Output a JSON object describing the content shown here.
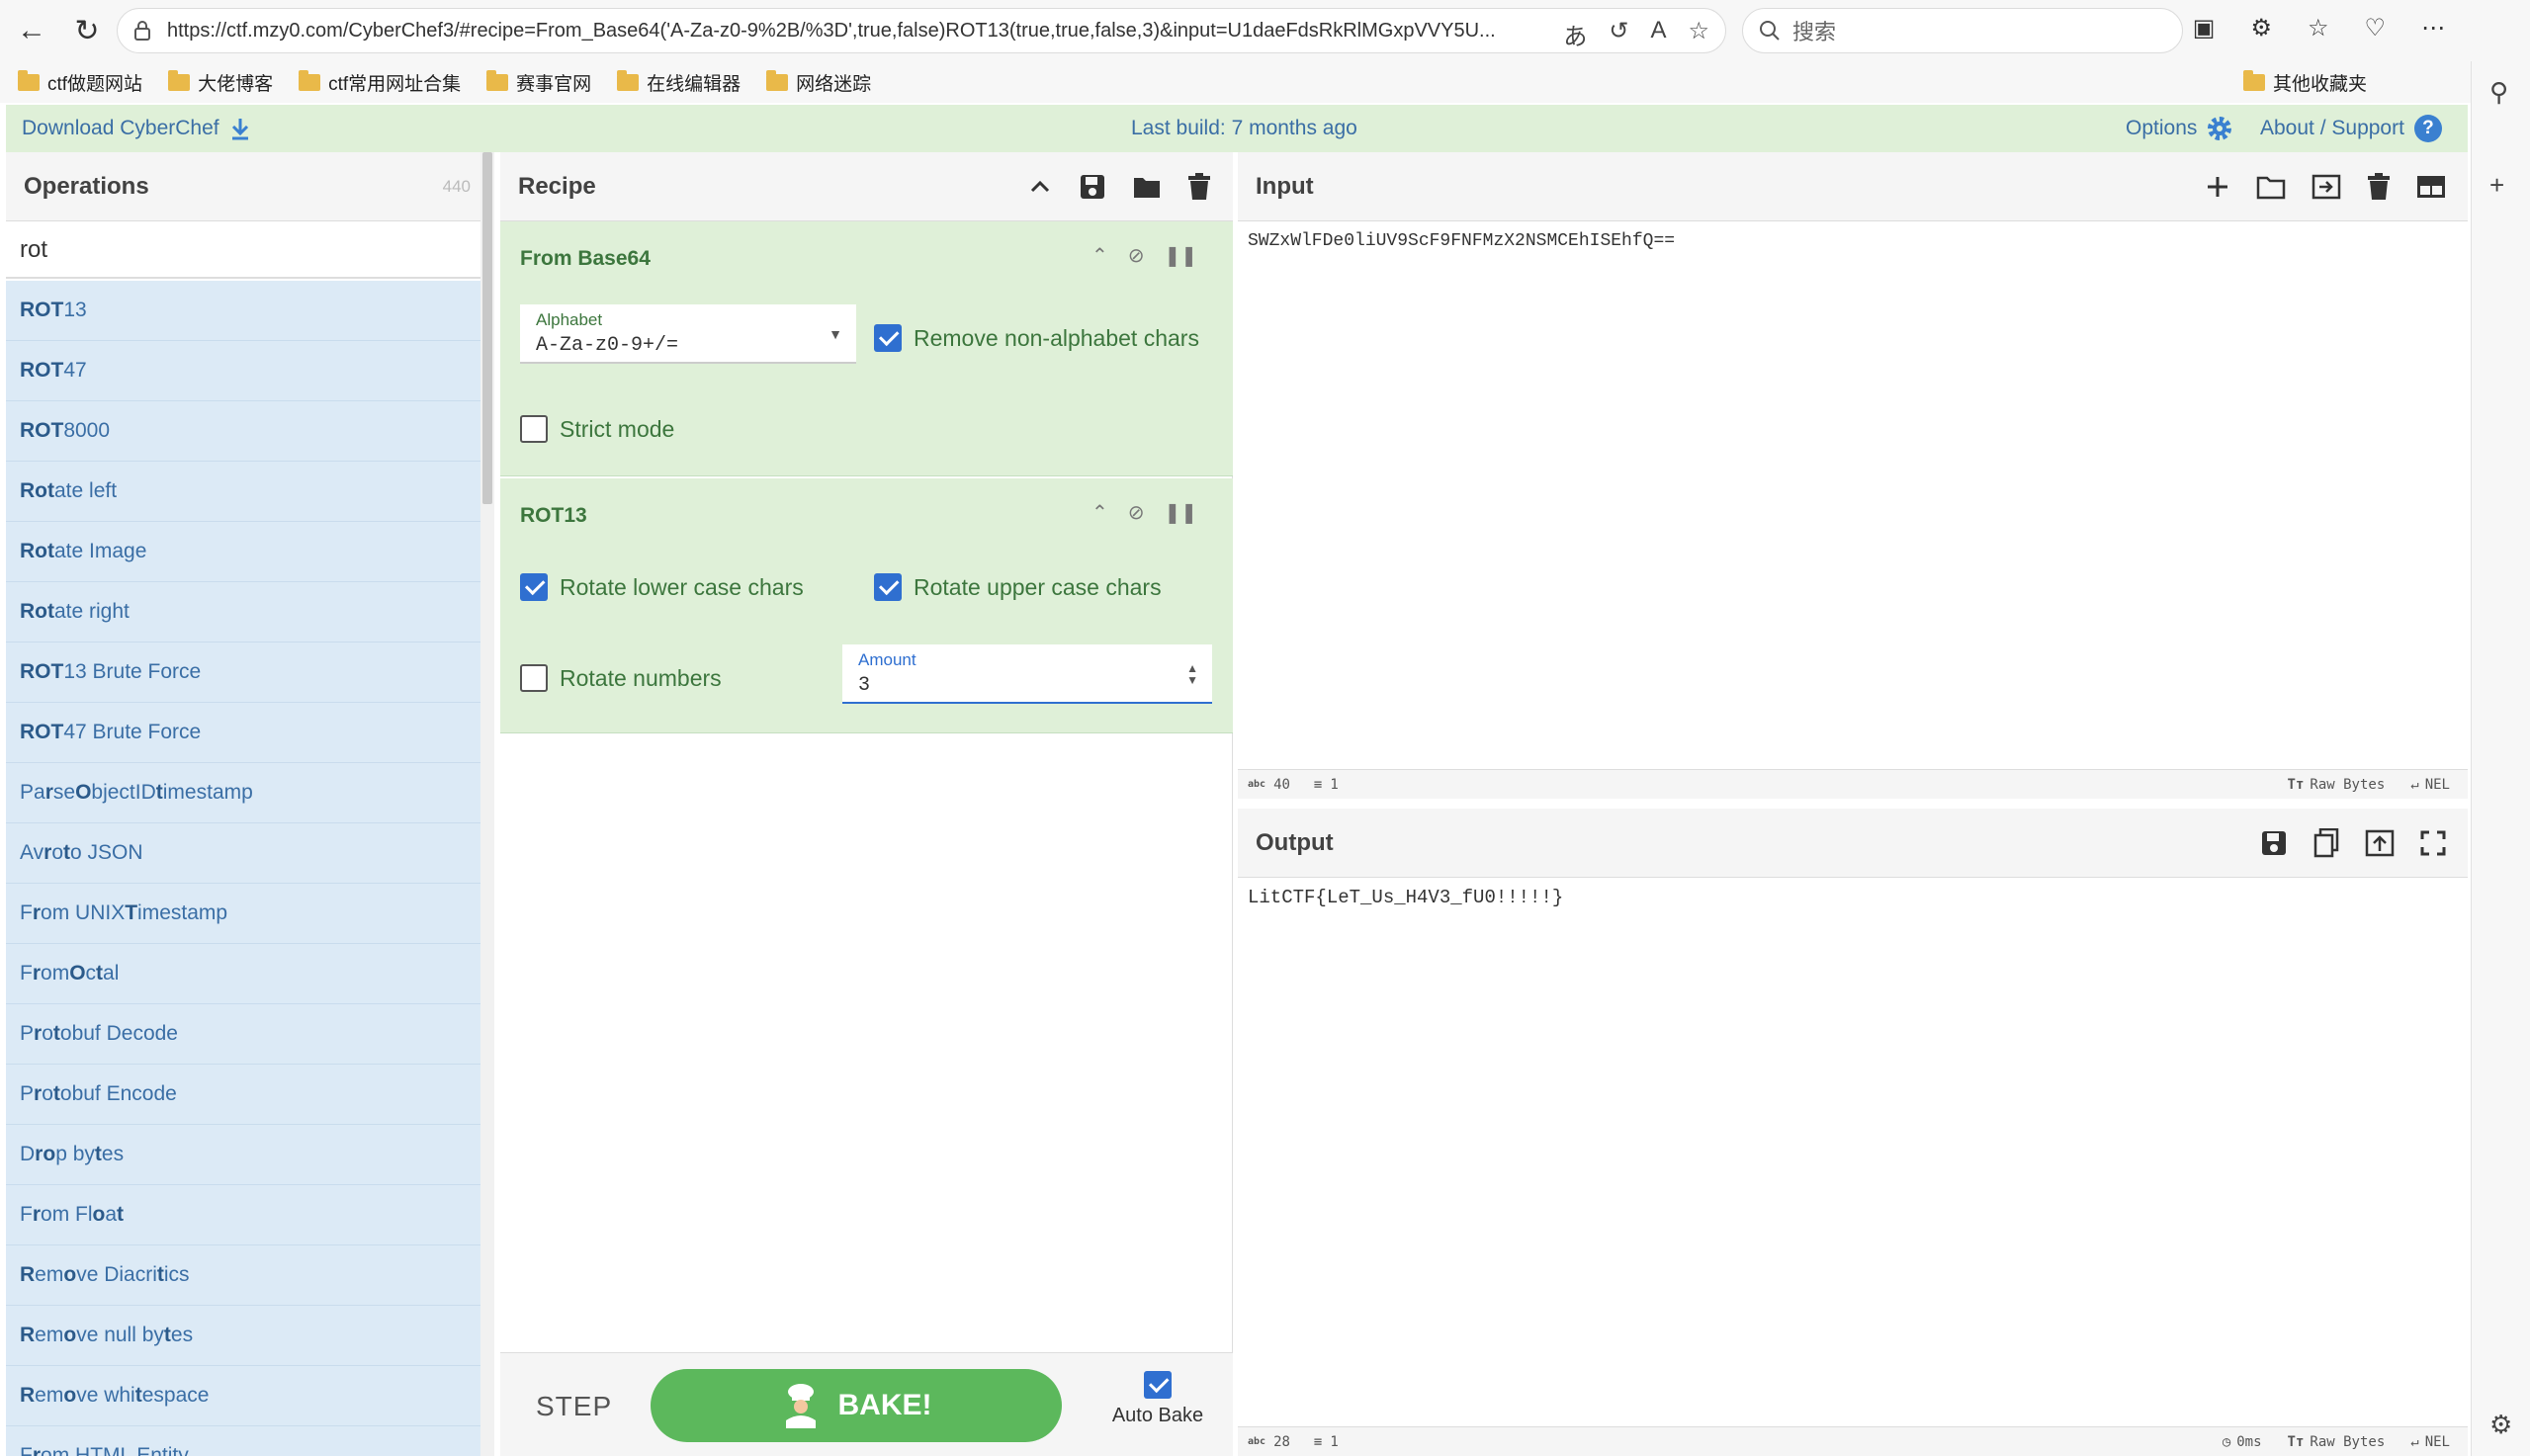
{
  "browser": {
    "url": "https://ctf.mzy0.com/CyberChef3/#recipe=From_Base64('A-Za-z0-9%2B/%3D',true,false)ROT13(true,true,false,3)&input=U1daeFdsRkRlMGxpVVY5U...",
    "search_placeholder": "搜索",
    "bookmarks": [
      "ctf做题网站",
      "大佬博客",
      "ctf常用网址合集",
      "赛事官网",
      "在线编辑器",
      "网络迷踪"
    ],
    "other_bookmarks": "其他收藏夹"
  },
  "banner": {
    "download": "Download CyberChef",
    "last_build": "Last build: 7 months ago",
    "options": "Options",
    "about": "About / Support"
  },
  "operations": {
    "title": "Operations",
    "count": "440",
    "search_value": "rot",
    "items": [
      {
        "bold": "ROT",
        "rest": "13"
      },
      {
        "bold": "ROT",
        "rest": "47"
      },
      {
        "bold": "ROT",
        "rest": "8000"
      },
      {
        "bold": "Rot",
        "rest": "ate left"
      },
      {
        "bold": "Rot",
        "rest": "ate Image"
      },
      {
        "bold": "Rot",
        "rest": "ate right"
      },
      {
        "bold": "ROT",
        "rest": "13 Brute Force"
      },
      {
        "bold": "ROT",
        "rest": "47 Brute Force"
      },
      {
        "html": "Pa<b>r</b>se <b>O</b>bjectID <b>t</b>imestamp"
      },
      {
        "html": "Av<b>r</b>o <b>t</b>o JSON"
      },
      {
        "html": "F<b>r</b>om UNIX <b>T</b>imestamp"
      },
      {
        "html": "F<b>r</b>om <b>O</b>c<b>t</b>al"
      },
      {
        "html": "P<b>r</b>o<b>t</b>obuf Decode"
      },
      {
        "html": "P<b>r</b>o<b>t</b>obuf Encode"
      },
      {
        "html": "D<b>r</b><b>o</b>p by<b>t</b>es"
      },
      {
        "html": "F<b>r</b>om Fl<b>o</b>a<b>t</b>"
      },
      {
        "html": "<b>R</b>em<b>o</b>ve Diacri<b>t</b>ics"
      },
      {
        "html": "<b>R</b>em<b>o</b>ve null by<b>t</b>es"
      },
      {
        "html": "<b>R</b>em<b>o</b>ve whi<b>t</b>espace"
      },
      {
        "html": "F<b>r</b>om HTML Entity"
      }
    ]
  },
  "recipe": {
    "title": "Recipe",
    "from_base64": {
      "title": "From Base64",
      "alphabet_label": "Alphabet",
      "alphabet_value": "A-Za-z0-9+/=",
      "remove_nonalpha": "Remove non-alphabet chars",
      "strict_mode": "Strict mode"
    },
    "rot13": {
      "title": "ROT13",
      "rotate_lower": "Rotate lower case chars",
      "rotate_upper": "Rotate upper case chars",
      "rotate_numbers": "Rotate numbers",
      "amount_label": "Amount",
      "amount_value": "3"
    },
    "step": "STEP",
    "bake": "BAKE!",
    "auto_bake": "Auto Bake"
  },
  "input": {
    "title": "Input",
    "text": "SWZxWlFDe0liUV9ScF9FNFMzX2NSMCEhISEhfQ==",
    "chars": "40",
    "lines": "1",
    "encoding": "Raw Bytes",
    "eol": "NEL"
  },
  "output": {
    "title": "Output",
    "text": "LitCTF{LeT_Us_H4V3_fU0!!!!!}",
    "chars": "28",
    "lines": "1",
    "time": "0ms",
    "encoding": "Raw Bytes",
    "eol": "NEL"
  }
}
